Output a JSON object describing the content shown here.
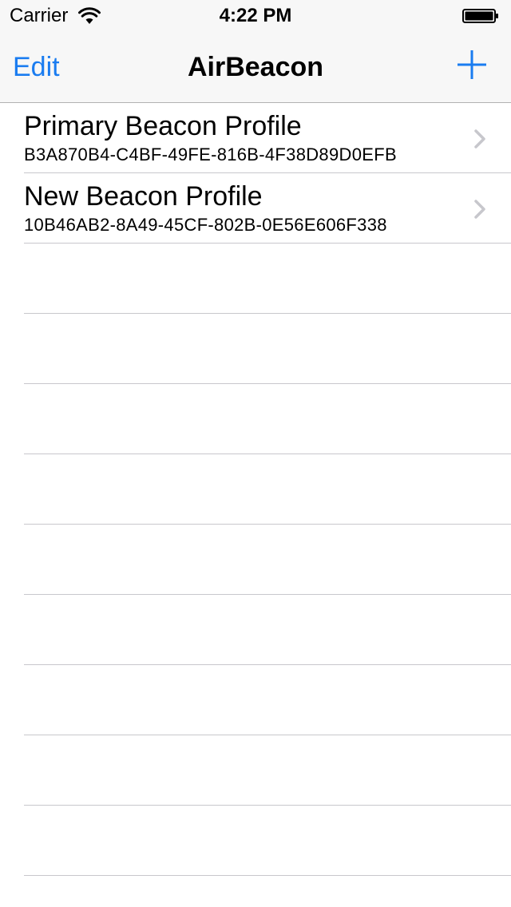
{
  "status_bar": {
    "carrier": "Carrier",
    "time": "4:22 PM",
    "icons": [
      "wifi-icon",
      "battery-icon"
    ]
  },
  "nav": {
    "edit_label": "Edit",
    "title": "AirBeacon",
    "add_icon": "plus-icon"
  },
  "colors": {
    "accent": "#1a7cf0",
    "bar_background": "#f7f7f7",
    "separator": "#c8c7cc",
    "chevron": "#c7c7cc"
  },
  "profiles": [
    {
      "name": "Primary Beacon Profile",
      "uuid": "B3A870B4-C4BF-49FE-816B-4F38D89D0EFB"
    },
    {
      "name": "New Beacon Profile",
      "uuid": "10B46AB2-8A49-45CF-802B-0E56E606F338"
    }
  ]
}
